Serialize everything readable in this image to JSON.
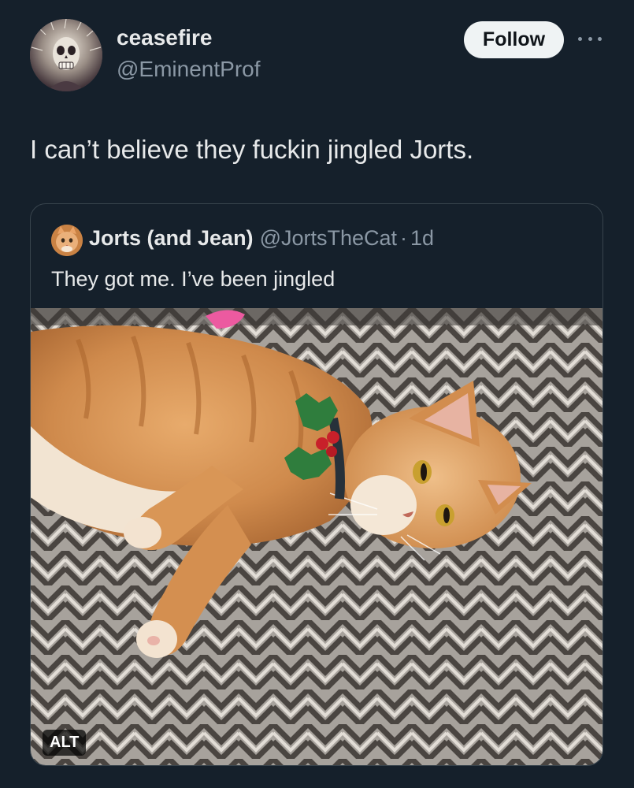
{
  "author": {
    "display_name": "ceasefire",
    "handle": "@EminentProf",
    "avatar_icon": "skull-avatar"
  },
  "follow_label": "Follow",
  "more_icon": "more-horizontal-icon",
  "tweet": {
    "text": "I can’t believe they fuckin jingled Jorts."
  },
  "quote": {
    "display_name": "Jorts (and Jean)",
    "handle": "@JortsTheCat",
    "separator": "·",
    "time": "1d",
    "text": "They got me. I’ve been jingled",
    "avatar_icon": "cat-avatar",
    "media": {
      "alt_label": "ALT"
    }
  },
  "colors": {
    "background": "#15202b",
    "text_primary": "#e7e9ea",
    "text_secondary": "#8b98a5",
    "border": "#38444d",
    "follow_bg": "#eff3f4"
  }
}
